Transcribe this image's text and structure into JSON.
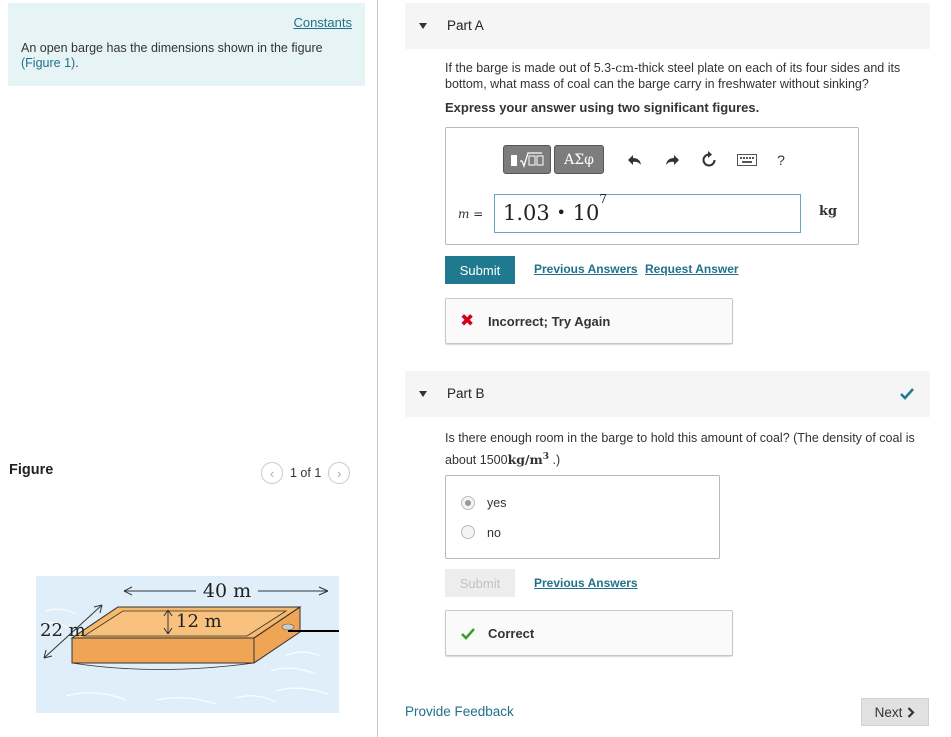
{
  "left": {
    "constants_link": "Constants",
    "intro_text": "An open barge has the dimensions shown in the figure",
    "intro_figure_link": "(Figure 1)",
    "intro_end": ".",
    "figure_title": "Figure",
    "pager_text": "1 of 1",
    "figure": {
      "length_label": "40 m",
      "height_label": "12 m",
      "width_label": "22 m",
      "colors": {
        "water": "#dfeef8",
        "barge_top": "#f6b96a",
        "barge_side": "#f0a455",
        "outline": "#333333"
      }
    }
  },
  "partA": {
    "label": "Part A",
    "question_1": "If the barge is made out of 5.3-",
    "question_unit": "cm",
    "question_2": "-thick steel plate on each of its four sides and its bottom, what mass of coal can the barge carry in freshwater without sinking?",
    "instruction": "Express your answer using two significant figures.",
    "toolbar": {
      "templates_icon": "templates-icon",
      "greek_label": "ΑΣφ",
      "help_label": "?"
    },
    "variable": "m",
    "equals": "=",
    "answer_mantissa": "1.03",
    "answer_dot": "•",
    "answer_base": "10",
    "answer_exp": "7",
    "unit": "kg",
    "submit_label": "Submit",
    "previous_answers": "Previous Answers",
    "request_answer": "Request Answer",
    "feedback_text": "Incorrect; Try Again",
    "feedback_color": "#d0021b"
  },
  "partB": {
    "label": "Part B",
    "question_1": "Is there enough room in the barge to hold this amount of coal? (The density of coal is about 1500",
    "question_unit": "kg/m",
    "question_exp": "3",
    "question_end": ".)",
    "options": [
      {
        "label": "yes",
        "selected": true
      },
      {
        "label": "no",
        "selected": false
      }
    ],
    "submit_label": "Submit",
    "previous_answers": "Previous Answers",
    "feedback_text": "Correct",
    "feedback_color": "#3a9b2d"
  },
  "footer": {
    "provide_feedback": "Provide Feedback",
    "next_label": "Next"
  }
}
